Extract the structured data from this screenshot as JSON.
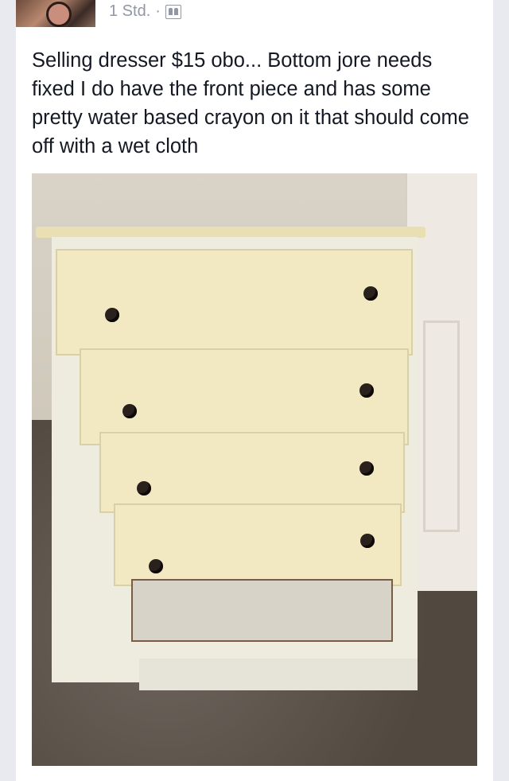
{
  "post": {
    "timestamp": "1 Std.",
    "separator": "·",
    "audience_icon": "friends-icon",
    "text": "Selling dresser $15 obo... Bottom jore needs fixed I do have the front piece and has some pretty water based crayon on it that should come off with a wet cloth"
  },
  "photo": {
    "subject": "dresser-photo"
  }
}
